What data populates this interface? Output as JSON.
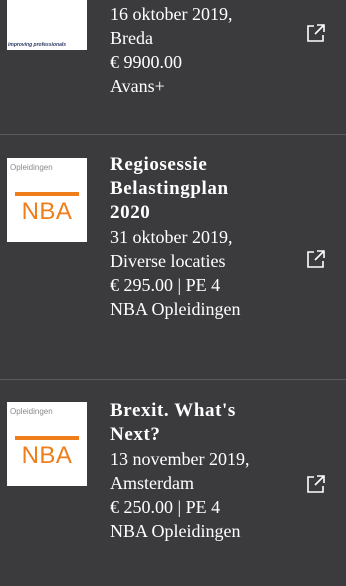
{
  "items": [
    {
      "thumbnail_tagline": "improving professionals",
      "date_location": "16 oktober 2019,",
      "location": "Breda",
      "price": "€ 9900.00",
      "provider": "Avans+",
      "link_icon": "external-link-icon"
    },
    {
      "thumbnail_caption": "Opleidingen",
      "thumbnail_logo": "NBA",
      "title_lines": [
        "Regiosessie",
        "Belastingplan",
        "2020"
      ],
      "date_location": "31 oktober 2019,",
      "location": "Diverse locaties",
      "price": "€ 295.00 | PE 4",
      "provider": "NBA Opleidingen",
      "link_icon": "external-link-icon"
    },
    {
      "thumbnail_caption": "Opleidingen",
      "thumbnail_logo": "NBA",
      "title_lines": [
        "Brexit. What's",
        "Next?"
      ],
      "date_location": "13 november 2019,",
      "location": "Amsterdam",
      "price": "€ 250.00 | PE 4",
      "provider": "NBA Opleidingen",
      "link_icon": "external-link-icon"
    }
  ],
  "colors": {
    "background": "#3b3b3e",
    "text": "#ffffff",
    "nba_orange": "#ef7d1a",
    "divider": "#5a5a5e"
  }
}
